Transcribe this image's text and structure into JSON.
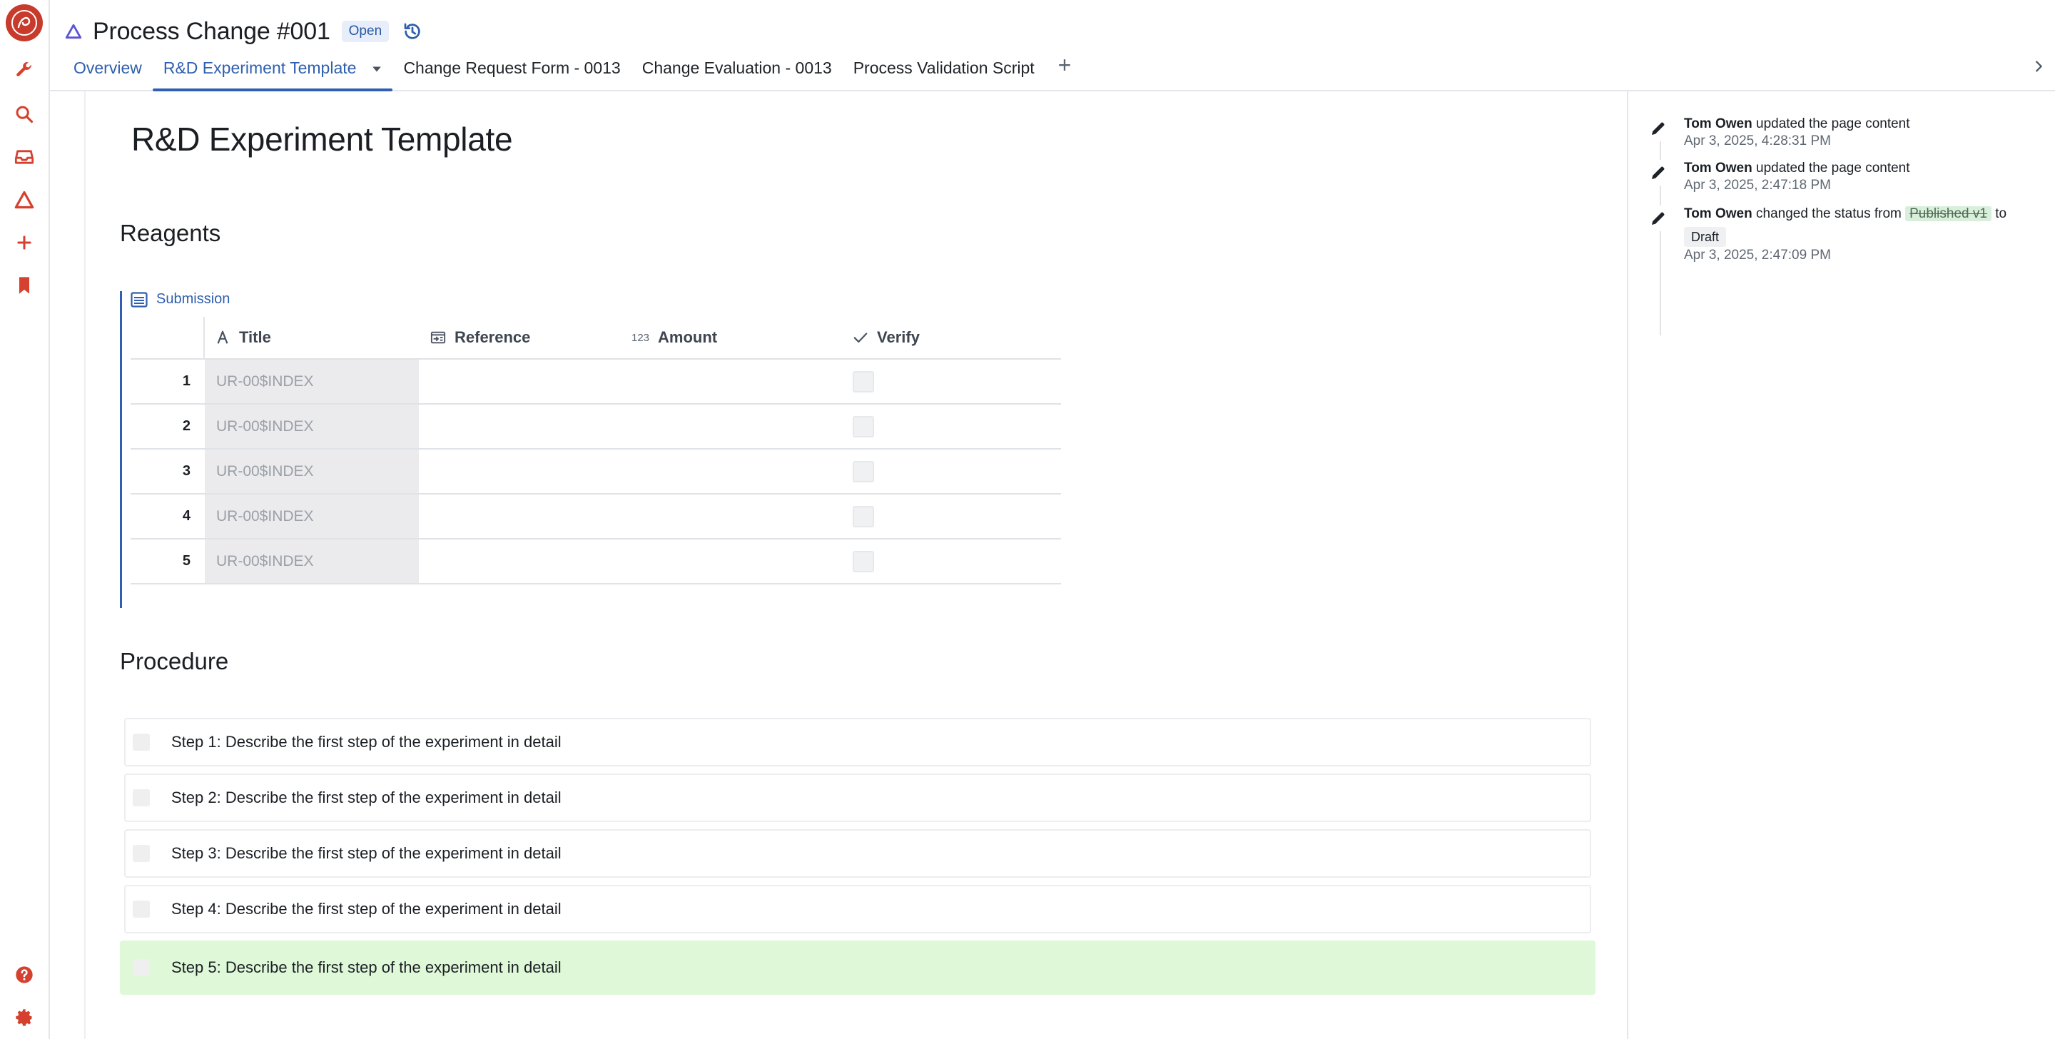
{
  "header": {
    "title": "Process Change #001",
    "status_badge": "Open"
  },
  "tabs": [
    {
      "label": "Overview"
    },
    {
      "label": "R&D Experiment Template"
    },
    {
      "label": "Change Request Form - 0013"
    },
    {
      "label": "Change Evaluation - 0013"
    },
    {
      "label": "Process Validation Script"
    }
  ],
  "tab_add_label": "+",
  "document": {
    "title": "R&D Experiment Template",
    "reagents_heading": "Reagents",
    "procedure_heading": "Procedure"
  },
  "form": {
    "label": "Submission",
    "columns": [
      "Title",
      "Reference",
      "Amount",
      "Verify"
    ],
    "amount_icon_text": "123",
    "rows": [
      {
        "index": "1",
        "title": "UR-00$INDEX"
      },
      {
        "index": "2",
        "title": "UR-00$INDEX"
      },
      {
        "index": "3",
        "title": "UR-00$INDEX"
      },
      {
        "index": "4",
        "title": "UR-00$INDEX"
      },
      {
        "index": "5",
        "title": "UR-00$INDEX"
      }
    ]
  },
  "steps": [
    "Step 1: Describe the first step of the experiment in detail",
    "Step 2: Describe the first step of the experiment in detail",
    "Step 3: Describe the first step of the experiment in detail",
    "Step 4: Describe the first step of the experiment in detail",
    "Step 5: Describe the first step of the experiment in detail"
  ],
  "activity": [
    {
      "user": "Tom Owen",
      "action": "updated the page content",
      "time": "Apr 3, 2025, 4:28:31 PM"
    },
    {
      "user": "Tom Owen",
      "action": "updated the page content",
      "time": "Apr 3, 2025, 2:47:18 PM"
    },
    {
      "user": "Tom Owen",
      "action": "changed the status from",
      "from_status": "Published v1",
      "to_word": "to",
      "to_status": "Draft",
      "time": "Apr 3, 2025, 2:47:09 PM"
    }
  ],
  "colors": {
    "accent": "#2f5fae",
    "brand_red": "#c73a2c",
    "highlight_green": "#dff8d8"
  },
  "icons": {
    "rail": [
      "wrench-icon",
      "search-icon",
      "inbox-icon",
      "delta-icon",
      "plus-icon",
      "bookmark-icon",
      "help-icon",
      "settings-icon"
    ]
  }
}
